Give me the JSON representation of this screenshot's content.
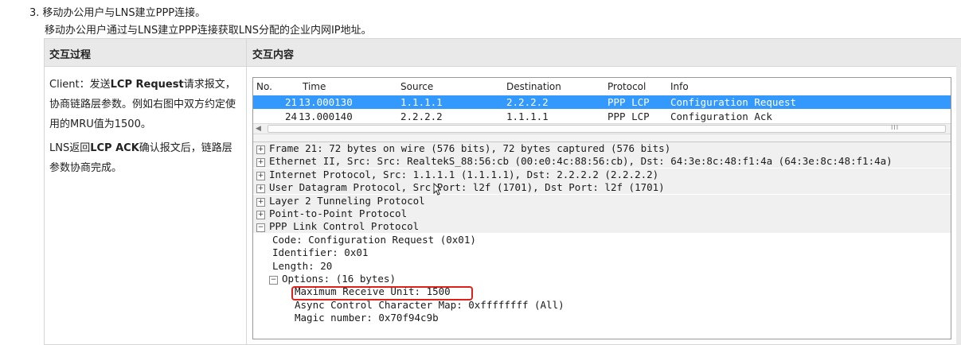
{
  "step": {
    "number": "3.",
    "title": "移动办公用户与LNS建立PPP连接。",
    "description": "移动办公用户通过与LNS建立PPP连接获取LNS分配的企业内网IP地址。"
  },
  "table": {
    "headers": [
      "交互过程",
      "交互内容"
    ],
    "left_cell": {
      "para1_prefix": "Client：发送",
      "para1_bold": "LCP Request",
      "para1_suffix": "请求报文，协商链路层参数。例如右图中双方约定使用的MRU值为1500。",
      "para2_prefix": "LNS返回",
      "para2_bold": "LCP ACK",
      "para2_suffix": "确认报文后，链路层参数协商完成。"
    }
  },
  "packet_list": {
    "columns": [
      "No.",
      "Time",
      "Source",
      "Destination",
      "Protocol",
      "Info"
    ],
    "rows": [
      {
        "no": "21",
        "time": "13.000130",
        "source": "1.1.1.1",
        "destination": "2.2.2.2",
        "protocol": "PPP LCP",
        "info": "Configuration Request",
        "selected": true
      },
      {
        "no": "24",
        "time": "13.000140",
        "source": "2.2.2.2",
        "destination": "1.1.1.1",
        "protocol": "PPP LCP",
        "info": "Configuration Ack",
        "selected": false
      }
    ],
    "scroll_grip": "III"
  },
  "details": [
    {
      "text": "Frame 21: 72 bytes on wire (576 bits), 72 bytes captured (576 bits)",
      "toggle": "+",
      "indent": 0
    },
    {
      "text": "Ethernet II, Src: Src: RealtekS_88:56:cb (00:e0:4c:88:56:cb), Dst: 64:3e:8c:48:f1:4a (64:3e:8c:48:f1:4a)",
      "toggle": "+",
      "indent": 0
    },
    {
      "text": "Internet Protocol, Src: 1.1.1.1 (1.1.1.1), Dst: 2.2.2.2 (2.2.2.2)",
      "toggle": "+",
      "indent": 0
    },
    {
      "text": "User Datagram Protocol, Src Port: l2f (1701), Dst Port: l2f (1701)",
      "toggle": "+",
      "indent": 0
    },
    {
      "text": "Layer 2 Tunneling Protocol",
      "toggle": "+",
      "indent": 0
    },
    {
      "text": "Point-to-Point Protocol",
      "toggle": "+",
      "indent": 0
    },
    {
      "text": "PPP Link Control Protocol",
      "toggle": "−",
      "indent": 0
    },
    {
      "text": "Code: Configuration Request (0x01)",
      "toggle": "",
      "indent": 1
    },
    {
      "text": "Identifier: 0x01",
      "toggle": "",
      "indent": 1
    },
    {
      "text": "Length: 20",
      "toggle": "",
      "indent": 1
    },
    {
      "text": "Options: (16 bytes)",
      "toggle": "−",
      "indent": 2
    },
    {
      "text": "Maximum Receive Unit: 1500",
      "toggle": "",
      "indent": 3
    },
    {
      "text": "Async Control Character Map: 0xffffffff (All)",
      "toggle": "",
      "indent": 3
    },
    {
      "text": "Magic number: 0x70f94c9b",
      "toggle": "",
      "indent": 3
    }
  ],
  "colors": {
    "selected_row": "#3399ff",
    "highlight_box": "#e0211a",
    "header_bg": "#e9e9e9"
  }
}
